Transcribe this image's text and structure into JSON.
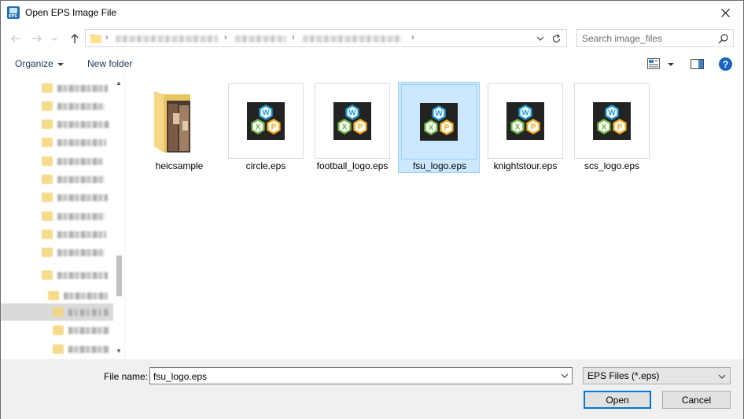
{
  "window": {
    "title": "Open EPS Image File",
    "icon_text": "EPS"
  },
  "nav": {
    "search_placeholder": "Search image_files"
  },
  "toolbar": {
    "organize_label": "Organize",
    "new_folder_label": "New folder",
    "help_label": "?"
  },
  "files": [
    {
      "name": "heicsample",
      "kind": "folder"
    },
    {
      "name": "circle.eps",
      "kind": "eps"
    },
    {
      "name": "football_logo.eps",
      "kind": "eps"
    },
    {
      "name": "fsu_logo.eps",
      "kind": "eps",
      "selected": true
    },
    {
      "name": "knightstour.eps",
      "kind": "eps"
    },
    {
      "name": "scs_logo.eps",
      "kind": "eps"
    }
  ],
  "logo": {
    "letters": [
      "W",
      "X",
      "P"
    ],
    "colors": {
      "w": "#1e9ad6",
      "x": "#6ab43e",
      "p": "#f2a81d",
      "bg": "#232323"
    }
  },
  "bottom": {
    "file_name_label": "File name:",
    "file_name_value": "fsu_logo.eps",
    "file_type": "EPS Files (*.eps)",
    "open_label": "Open",
    "cancel_label": "Cancel"
  },
  "colors": {
    "selection_bg": "#cce8ff",
    "selection_border": "#99d1ff",
    "accent": "#0078d7"
  }
}
